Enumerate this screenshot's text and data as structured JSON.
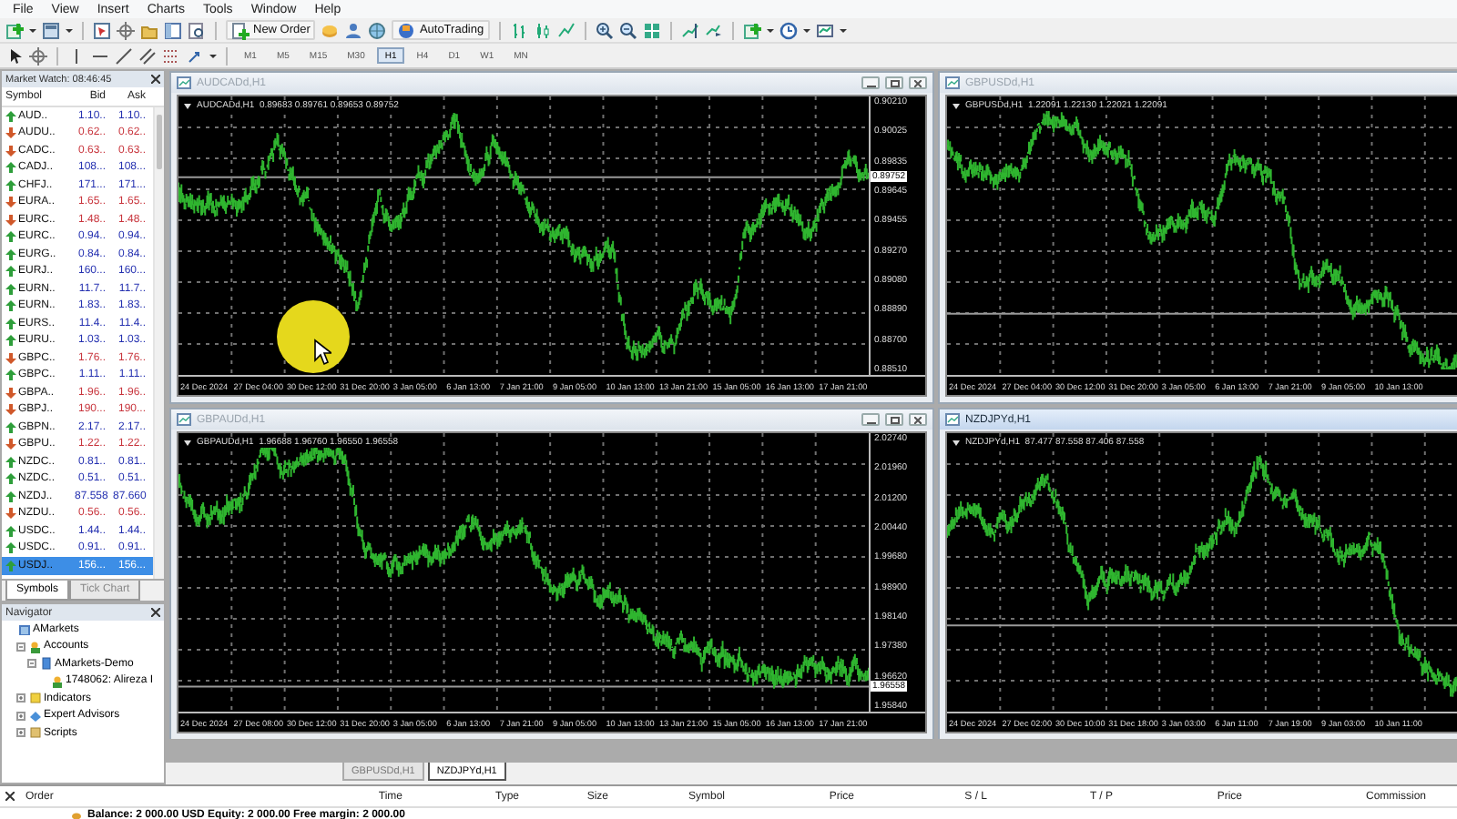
{
  "menu": [
    "File",
    "View",
    "Insert",
    "Charts",
    "Tools",
    "Window",
    "Help"
  ],
  "toolbar": {
    "new_order": "New Order",
    "auto_trading": "AutoTrading"
  },
  "timeframes": [
    {
      "label": "M1",
      "selected": false
    },
    {
      "label": "M5",
      "selected": false
    },
    {
      "label": "M15",
      "selected": false
    },
    {
      "label": "M30",
      "selected": false
    },
    {
      "label": "H1",
      "selected": true
    },
    {
      "label": "H4",
      "selected": false
    },
    {
      "label": "D1",
      "selected": false
    },
    {
      "label": "W1",
      "selected": false
    },
    {
      "label": "MN",
      "selected": false
    }
  ],
  "market_watch": {
    "title": "Market Watch: 08:46:45",
    "columns": [
      "Symbol",
      "Bid",
      "Ask"
    ],
    "rows": [
      {
        "symbol": "AUD..",
        "bid": "1.10..",
        "ask": "1.10..",
        "kind": "up",
        "selected": false
      },
      {
        "symbol": "AUDU..",
        "bid": "0.62..",
        "ask": "0.62..",
        "kind": "down",
        "selected": false
      },
      {
        "symbol": "CADC..",
        "bid": "0.63..",
        "ask": "0.63..",
        "kind": "down",
        "selected": false
      },
      {
        "symbol": "CADJ..",
        "bid": "108...",
        "ask": "108...",
        "kind": "up",
        "selected": false
      },
      {
        "symbol": "CHFJ..",
        "bid": "171...",
        "ask": "171...",
        "kind": "up",
        "selected": false
      },
      {
        "symbol": "EURA..",
        "bid": "1.65..",
        "ask": "1.65..",
        "kind": "down",
        "selected": false
      },
      {
        "symbol": "EURC..",
        "bid": "1.48..",
        "ask": "1.48..",
        "kind": "down",
        "selected": false
      },
      {
        "symbol": "EURC..",
        "bid": "0.94..",
        "ask": "0.94..",
        "kind": "up",
        "selected": false
      },
      {
        "symbol": "EURG..",
        "bid": "0.84..",
        "ask": "0.84..",
        "kind": "up",
        "selected": false
      },
      {
        "symbol": "EURJ..",
        "bid": "160...",
        "ask": "160...",
        "kind": "up",
        "selected": false
      },
      {
        "symbol": "EURN..",
        "bid": "11.7..",
        "ask": "11.7..",
        "kind": "up",
        "selected": false
      },
      {
        "symbol": "EURN..",
        "bid": "1.83..",
        "ask": "1.83..",
        "kind": "up",
        "selected": false
      },
      {
        "symbol": "EURS..",
        "bid": "11.4..",
        "ask": "11.4..",
        "kind": "up",
        "selected": false
      },
      {
        "symbol": "EURU..",
        "bid": "1.03..",
        "ask": "1.03..",
        "kind": "up",
        "selected": false
      },
      {
        "symbol": "GBPC..",
        "bid": "1.76..",
        "ask": "1.76..",
        "kind": "down",
        "selected": false
      },
      {
        "symbol": "GBPC..",
        "bid": "1.11..",
        "ask": "1.11..",
        "kind": "up",
        "selected": false
      },
      {
        "symbol": "GBPA..",
        "bid": "1.96..",
        "ask": "1.96..",
        "kind": "down",
        "selected": false
      },
      {
        "symbol": "GBPJ..",
        "bid": "190...",
        "ask": "190...",
        "kind": "down",
        "selected": false
      },
      {
        "symbol": "GBPN..",
        "bid": "2.17..",
        "ask": "2.17..",
        "kind": "up",
        "selected": false
      },
      {
        "symbol": "GBPU..",
        "bid": "1.22..",
        "ask": "1.22..",
        "kind": "down",
        "selected": false
      },
      {
        "symbol": "NZDC..",
        "bid": "0.81..",
        "ask": "0.81..",
        "kind": "up",
        "selected": false
      },
      {
        "symbol": "NZDC..",
        "bid": "0.51..",
        "ask": "0.51..",
        "kind": "up",
        "selected": false
      },
      {
        "symbol": "NZDJ..",
        "bid": "87.558",
        "ask": "87.660",
        "kind": "up",
        "selected": false
      },
      {
        "symbol": "NZDU..",
        "bid": "0.56..",
        "ask": "0.56..",
        "kind": "down",
        "selected": false
      },
      {
        "symbol": "USDC..",
        "bid": "1.44..",
        "ask": "1.44..",
        "kind": "up",
        "selected": false
      },
      {
        "symbol": "USDC..",
        "bid": "0.91..",
        "ask": "0.91..",
        "kind": "up",
        "selected": false
      },
      {
        "symbol": "USDJ..",
        "bid": "156...",
        "ask": "156...",
        "kind": "up",
        "selected": true
      }
    ],
    "tabs": [
      {
        "label": "Symbols",
        "selected": true
      },
      {
        "label": "Tick Chart",
        "selected": false
      }
    ]
  },
  "navigator": {
    "title": "Navigator",
    "tree": [
      {
        "label": "AMarkets",
        "kind": "broker",
        "children": [
          {
            "label": "Accounts",
            "kind": "accounts",
            "expanded": true,
            "children": [
              {
                "label": "AMarkets-Demo",
                "kind": "server",
                "expanded": true,
                "children": [
                  {
                    "label": "1748062: Alireza I",
                    "kind": "account"
                  }
                ]
              }
            ]
          },
          {
            "label": "Indicators",
            "kind": "indicators",
            "expanded": false
          },
          {
            "label": "Expert Advisors",
            "kind": "experts",
            "expanded": false
          },
          {
            "label": "Scripts",
            "kind": "scripts",
            "expanded": false
          }
        ]
      }
    ]
  },
  "charts": [
    {
      "title": "AUDCADd,H1",
      "info": "AUDCADd,H1  0.89683 0.89761 0.89653 0.89752",
      "active": false,
      "prices": [
        "0.90210",
        "0.90025",
        "0.89835",
        "0.89645",
        "0.89455",
        "0.89270",
        "0.89080",
        "0.88890",
        "0.88700",
        "0.88510"
      ],
      "current_price": "0.89752",
      "times": [
        "24 Dec 2024",
        "27 Dec 04:00",
        "30 Dec 12:00",
        "31 Dec 20:00",
        "3 Jan 05:00",
        "6 Jan 13:00",
        "7 Jan 21:00",
        "9 Jan 05:00",
        "10 Jan 13:00",
        "13 Jan 21:00",
        "15 Jan 05:00",
        "16 Jan 13:00",
        "17 Jan 21:00"
      ]
    },
    {
      "title": "GBPUSDd,H1",
      "info": "GBPUSDd,H1  1.22091 1.22130 1.22021 1.22091",
      "active": false,
      "times": [
        "24 Dec 2024",
        "27 Dec 04:00",
        "30 Dec 12:00",
        "31 Dec 20:00",
        "3 Jan 05:00",
        "6 Jan 13:00",
        "7 Jan 21:00",
        "9 Jan 05:00",
        "10 Jan 13:00"
      ]
    },
    {
      "title": "GBPAUDd,H1",
      "info": "GBPAUDd,H1  1.96688 1.96760 1.96550 1.96558",
      "active": false,
      "prices": [
        "2.02740",
        "2.01960",
        "2.01200",
        "2.00440",
        "1.99680",
        "1.98900",
        "1.98140",
        "1.97380",
        "1.96620",
        "1.95840"
      ],
      "current_price": "1.96558",
      "times": [
        "24 Dec 2024",
        "27 Dec 08:00",
        "30 Dec 12:00",
        "31 Dec 20:00",
        "3 Jan 05:00",
        "6 Jan 13:00",
        "7 Jan 21:00",
        "9 Jan 05:00",
        "10 Jan 13:00",
        "13 Jan 21:00",
        "15 Jan 05:00",
        "16 Jan 13:00",
        "17 Jan 21:00"
      ]
    },
    {
      "title": "NZDJPYd,H1",
      "info": "NZDJPYd,H1  87.477 87.558 87.406 87.558",
      "active": true,
      "times": [
        "24 Dec 2024",
        "27 Dec 02:00",
        "30 Dec 10:00",
        "31 Dec 18:00",
        "3 Jan 03:00",
        "6 Jan 11:00",
        "7 Jan 19:00",
        "9 Jan 03:00",
        "10 Jan 11:00"
      ]
    }
  ],
  "chart_tabs": [
    {
      "label": "GBPUSDd,H1",
      "selected": false
    },
    {
      "label": "NZDJPYd,H1",
      "selected": true
    }
  ],
  "terminal": {
    "columns": [
      "Order",
      "Time",
      "Type",
      "Size",
      "Symbol",
      "Price",
      "S / L",
      "T / P",
      "Price",
      "Commission"
    ],
    "balance": "Balance: 2 000.00 USD  Equity: 2 000.00  Free margin: 2 000.00"
  }
}
